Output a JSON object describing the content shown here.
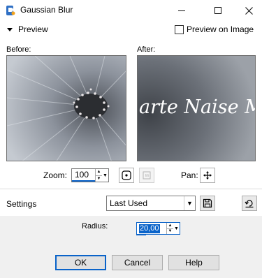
{
  "window": {
    "title": "Gaussian Blur"
  },
  "preview": {
    "header_label": "Preview",
    "preview_on_image_label": "Preview on Image",
    "before_label": "Before:",
    "after_label": "After:",
    "watermark_text": "arte Naise M"
  },
  "zoom": {
    "label": "Zoom:",
    "value": "100"
  },
  "pan": {
    "label": "Pan:"
  },
  "settings": {
    "label": "Settings",
    "selected": "Last Used"
  },
  "radius": {
    "label": "Radius:",
    "value": "20,00"
  },
  "buttons": {
    "ok": "OK",
    "cancel": "Cancel",
    "help": "Help"
  },
  "colors": {
    "accent": "#0a63c9",
    "dialog_bg": "#f0f0f0"
  }
}
